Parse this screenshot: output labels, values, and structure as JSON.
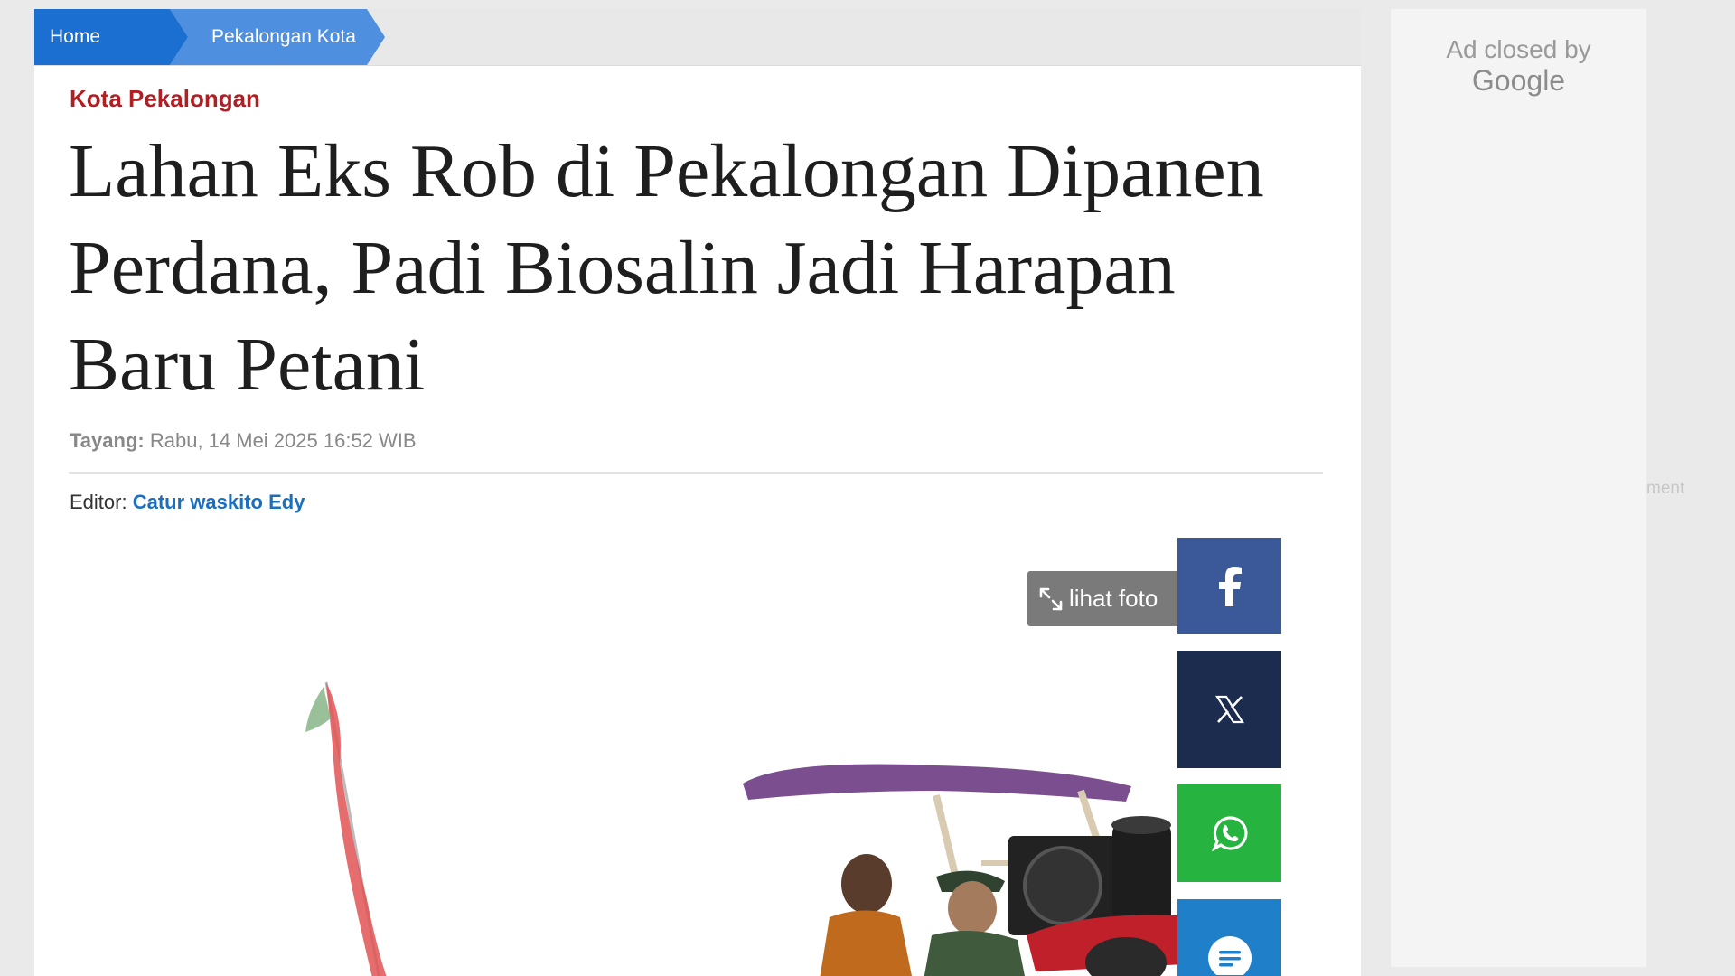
{
  "breadcrumb": {
    "home": "Home",
    "section": "Pekalongan Kota"
  },
  "article": {
    "category": "Kota Pekalongan",
    "headline_line1": "Lahan Eks Rob di Pekalongan Dipanen",
    "headline_line2": "Perdana, Padi Biosalin Jadi Harapan",
    "headline_line3": "Baru Petani",
    "published_label": "Tayang:",
    "published_value": "Rabu, 14 Mei 2025 16:52 WIB",
    "editor_label": "Editor:",
    "editor_name": "Catur waskito Edy",
    "view_photo_label": "lihat foto"
  },
  "share": {
    "icons": [
      "facebook-icon",
      "x-icon",
      "whatsapp-icon",
      "comment-icon"
    ],
    "colors": {
      "facebook": "#3b5998",
      "x": "#1c2c4f",
      "whatsapp": "#27b33f",
      "comment": "#1f7fc9"
    }
  },
  "ad": {
    "closed_text": "Ad closed by",
    "brand": "Google",
    "peek_text": "ment"
  },
  "colors": {
    "category": "#b01f24",
    "link": "#1a6fc0",
    "breadcrumb_home": "#1a6fd0",
    "breadcrumb_section": "#4f8fe0"
  }
}
